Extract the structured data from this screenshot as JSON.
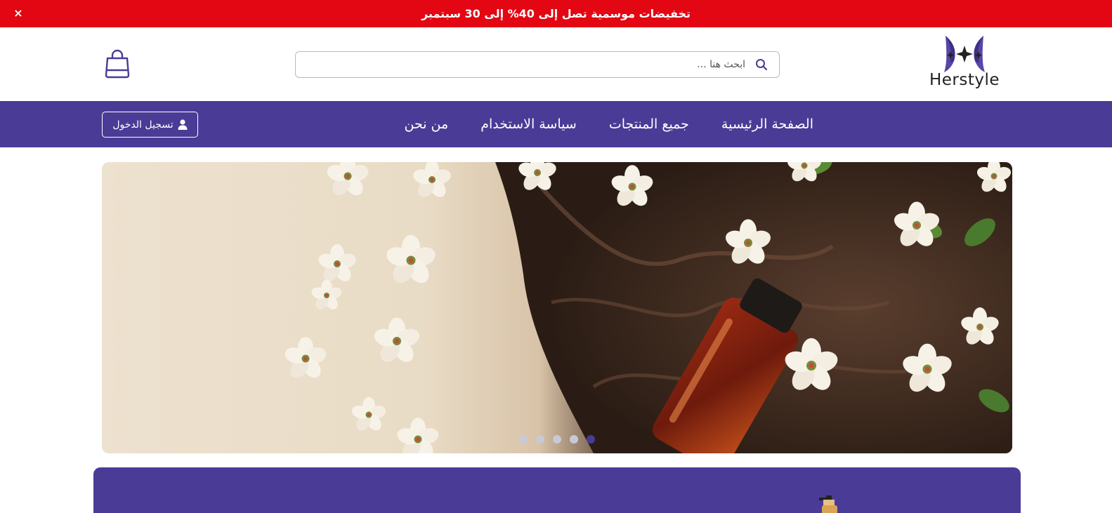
{
  "promo": {
    "text": "تخفيضات موسمية تصل إلى 40% إلى 30 سبتمبر",
    "close_label": "×"
  },
  "header": {
    "logo_text": "Herstyle",
    "search_placeholder": "ابحث هنا ..."
  },
  "nav": {
    "links": [
      {
        "label": "الصفحة الرئيسية"
      },
      {
        "label": "جميع المنتجات"
      },
      {
        "label": "سياسة الاستخدام"
      },
      {
        "label": "من نحن"
      }
    ],
    "login_label": "تسجيل الدخول"
  },
  "hero": {
    "slide_count": 5,
    "active_slide": 5
  },
  "colors": {
    "promo_bg": "#e30613",
    "brand": "#4a3b96",
    "dot_inactive": "#c9c9d6"
  }
}
